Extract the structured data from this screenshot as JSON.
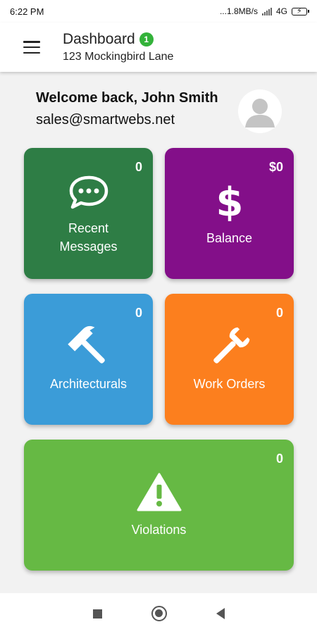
{
  "status_bar": {
    "time": "6:22 PM",
    "network_speed": "...1.8MB/s",
    "network_type": "4G"
  },
  "app_bar": {
    "title": "Dashboard",
    "badge_count": "1",
    "subtitle": "123 Mockingbird Lane",
    "menu_icon": "hamburger-menu-icon"
  },
  "welcome": {
    "greeting": "Welcome back, John Smith",
    "email": "sales@smartwebs.net"
  },
  "tiles": [
    {
      "label_line1": "Recent",
      "label_line2": "Messages",
      "count": "0",
      "color": "#2e7d45",
      "icon": "chat-bubble-icon"
    },
    {
      "label": "Balance",
      "count": "$0",
      "color": "#830f89",
      "icon": "dollar-sign-icon"
    },
    {
      "label": "Architecturals",
      "count": "0",
      "color": "#3b9cd8",
      "icon": "hammer-icon"
    },
    {
      "label": "Work Orders",
      "count": "0",
      "color": "#fc7f1e",
      "icon": "wrench-icon"
    },
    {
      "label": "Violations",
      "count": "0",
      "color": "#66b944",
      "icon": "warning-triangle-icon"
    }
  ],
  "nav_bar": {
    "icons": [
      "recents-square-icon",
      "home-circle-icon",
      "back-triangle-icon"
    ]
  }
}
